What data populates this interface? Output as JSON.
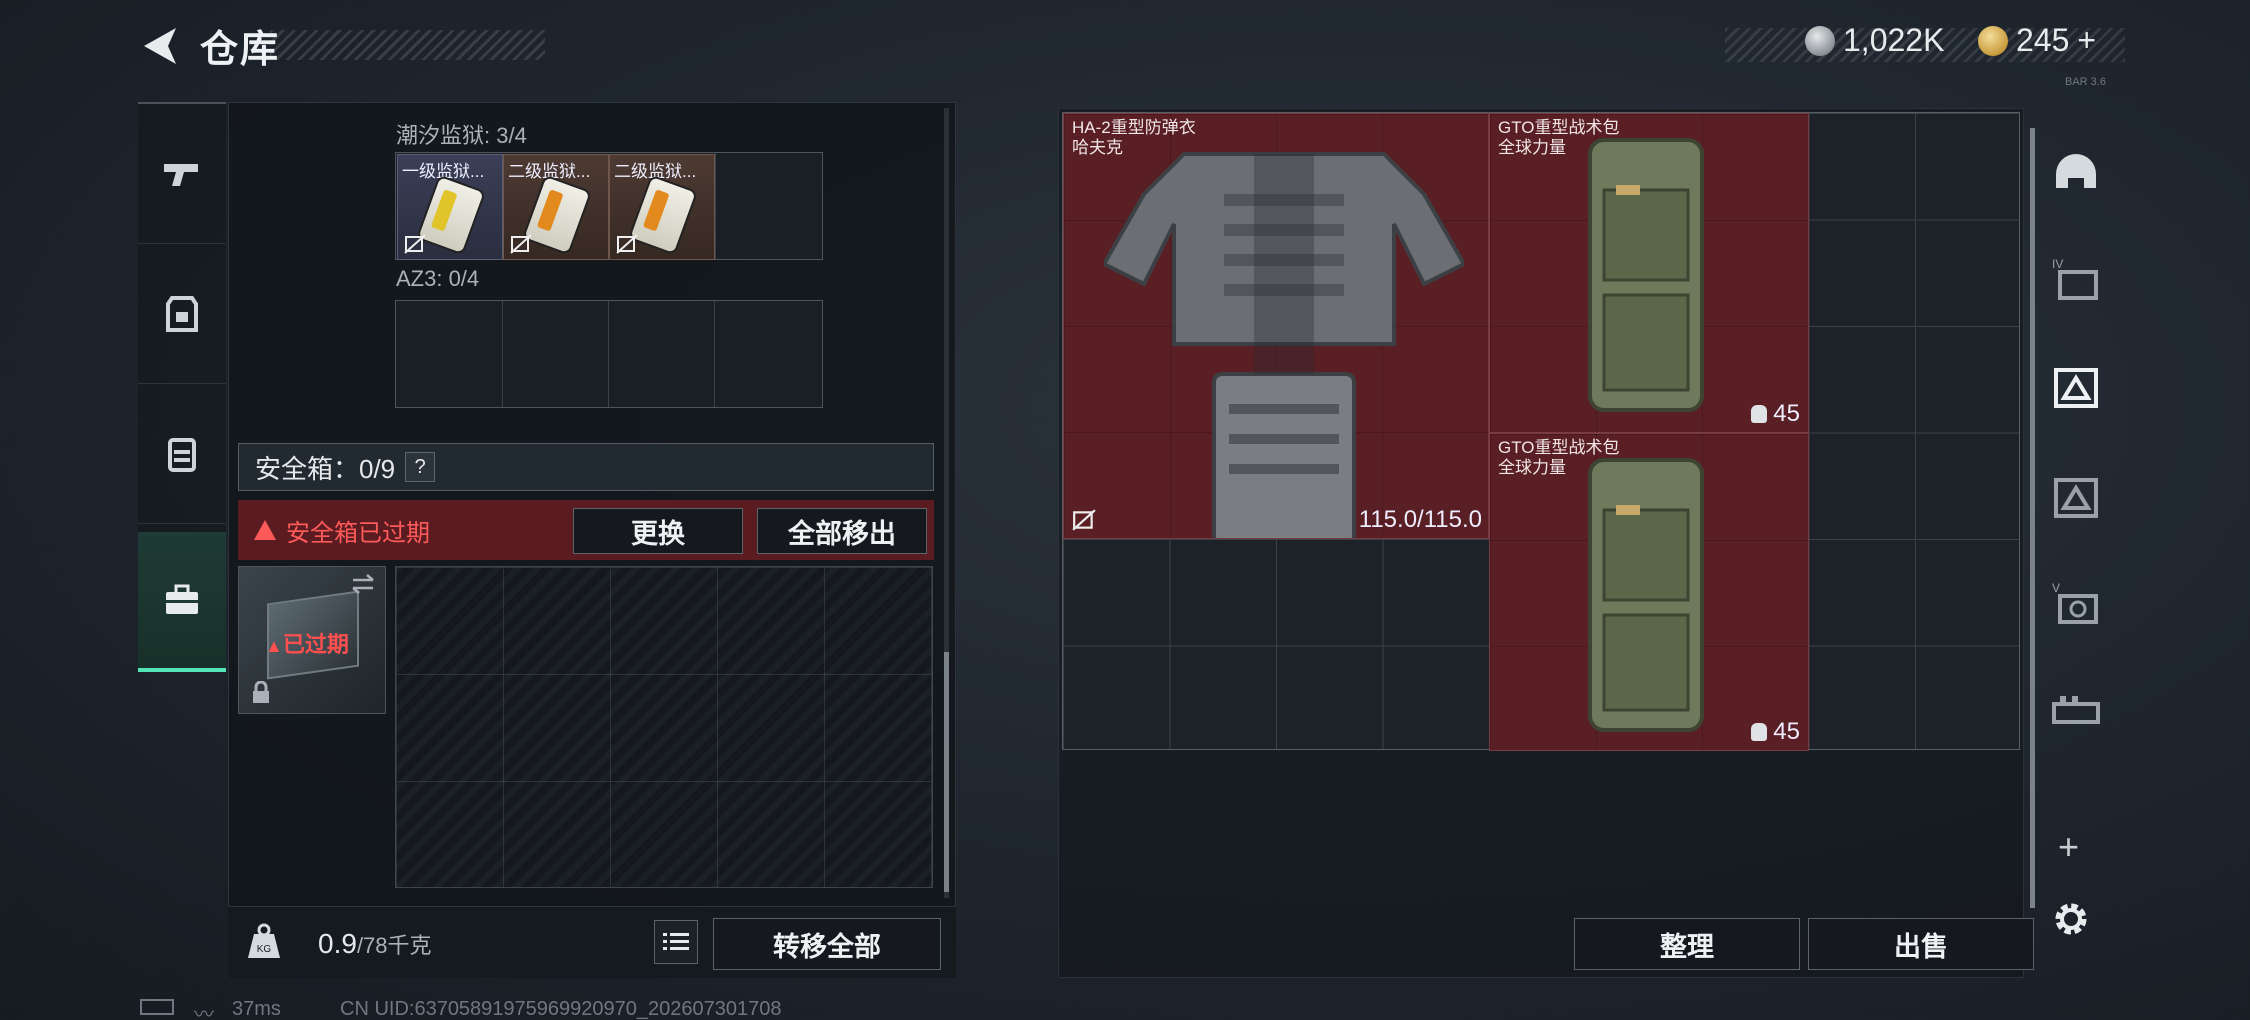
{
  "header": {
    "title": "仓库",
    "currency_silver": "1,022K",
    "currency_gold": "245",
    "gold_plus": "+",
    "version_text": "BAR 3.6"
  },
  "left_tabs": [
    {
      "name": "weapons-tab",
      "icon": "pistol-icon"
    },
    {
      "name": "gear-tab",
      "icon": "armor-icon"
    },
    {
      "name": "backpack-tab",
      "icon": "backpack-icon"
    },
    {
      "name": "safebox-tab",
      "icon": "toolbox-icon",
      "active": true
    }
  ],
  "left_panel": {
    "section1_label": "潮汐监狱: 3/4",
    "section1_cards": [
      {
        "label": "一级监狱...",
        "color": "yellow",
        "variant": "blue"
      },
      {
        "label": "二级监狱...",
        "color": "orange",
        "variant": "brown"
      },
      {
        "label": "二级监狱...",
        "color": "orange",
        "variant": "brown"
      }
    ],
    "section2_label": "AZ3: 0/4",
    "safebox_label": "安全箱：0/9",
    "help_glyph": "?",
    "expired_warning": "安全箱已过期",
    "replace_button": "更换",
    "move_all_out_button": "全部移出",
    "safebox_status": "已过期",
    "weight": "0.9",
    "weight_max": "/78千克",
    "transfer_all_button": "转移全部"
  },
  "right_panel": {
    "items": [
      {
        "name": "HA-2重型防弹衣",
        "brand": "哈夫克",
        "durability": "115.0/115.0"
      },
      {
        "name": "GTO重型战术包",
        "brand": "全球力量",
        "capacity": "45"
      },
      {
        "name": "GTO重型战术包",
        "brand": "全球力量",
        "capacity": "45"
      }
    ],
    "sort_button": "整理",
    "sell_button": "出售"
  },
  "right_sidebar": [
    {
      "name": "helmet-slot",
      "icon": "helmet-icon"
    },
    {
      "name": "container-slot-iv",
      "icon": "container-icon"
    },
    {
      "name": "container-slot-active",
      "icon": "container-icon"
    },
    {
      "name": "container-slot-2",
      "icon": "container-icon"
    },
    {
      "name": "container-slot-v",
      "icon": "container-icon"
    },
    {
      "name": "container-slot-3",
      "icon": "container-icon"
    }
  ],
  "status_bar": {
    "ping": "37ms",
    "uid": "CN UID:6370589197596992097​0_202607301708"
  },
  "colors": {
    "accent_green": "#54e6b6",
    "item_red": "#5a1f25",
    "warning_red": "#ff5a5a"
  }
}
